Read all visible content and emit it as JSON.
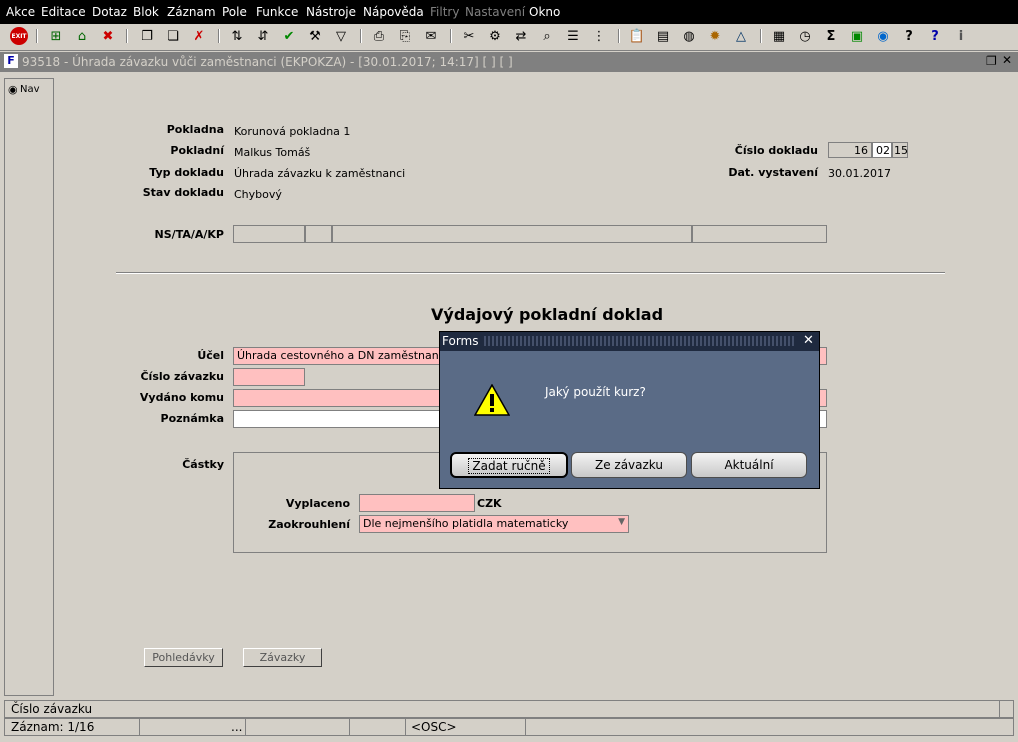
{
  "menu": [
    "Akce",
    "Editace",
    "Dotaz",
    "Blok",
    "Záznam",
    "Pole",
    "Funkce",
    "Nástroje",
    "Nápověda",
    "Filtry",
    "Nastavení",
    "Okno"
  ],
  "window": {
    "title": "93518 - Úhrada závazku vůči zaměstnanci (EKPOKZA) - [30.01.2017; 14:17]  [ ]  [ ]",
    "nav_label": "Nav"
  },
  "header": {
    "pokladna_label": "Pokladna",
    "pokladna_value": "Korunová pokladna 1",
    "pokladni_label": "Pokladní",
    "pokladni_value": "Malkus Tomáš",
    "typ_label": "Typ dokladu",
    "typ_value": "Úhrada závazku k zaměstnanci",
    "stav_label": "Stav dokladu",
    "stav_value": "Chybový",
    "cislo_label": "Číslo dokladu",
    "cislo_1": "16",
    "cislo_2": "02",
    "cislo_3": "15",
    "dat_label": "Dat. vystavení",
    "dat_value": "30.01.2017",
    "ns_label": "NS/TA/A/KP"
  },
  "form": {
    "heading": "Výdajový pokladní doklad",
    "ucel_label": "Účel",
    "ucel_value": "Úhrada cestovného a DN zaměstnanci",
    "cislo_zav_label": "Číslo závazku",
    "vydano_label": "Vydáno komu",
    "poznamka_label": "Poznámka",
    "castky_label": "Částky",
    "vyplaceno_label": "Vyplaceno",
    "currency": "CZK",
    "zaokrouhleni_label": "Zaokrouhlení",
    "zaokrouhleni_value": "Dle nejmenšího platidla matematicky"
  },
  "buttons": {
    "pohledavky": "Pohledávky",
    "zavazky": "Závazky"
  },
  "dialog": {
    "title": "Forms",
    "message": "Jaký použít kurz?",
    "btn_manual": "Zadat ručně",
    "btn_zavazek": "Ze závazku",
    "btn_aktualni": "Aktuální",
    "close": "✕"
  },
  "status": {
    "line1": "Číslo závazku",
    "record": "Záznam: 1/16",
    "dots": "...",
    "osc": "<OSC>"
  }
}
